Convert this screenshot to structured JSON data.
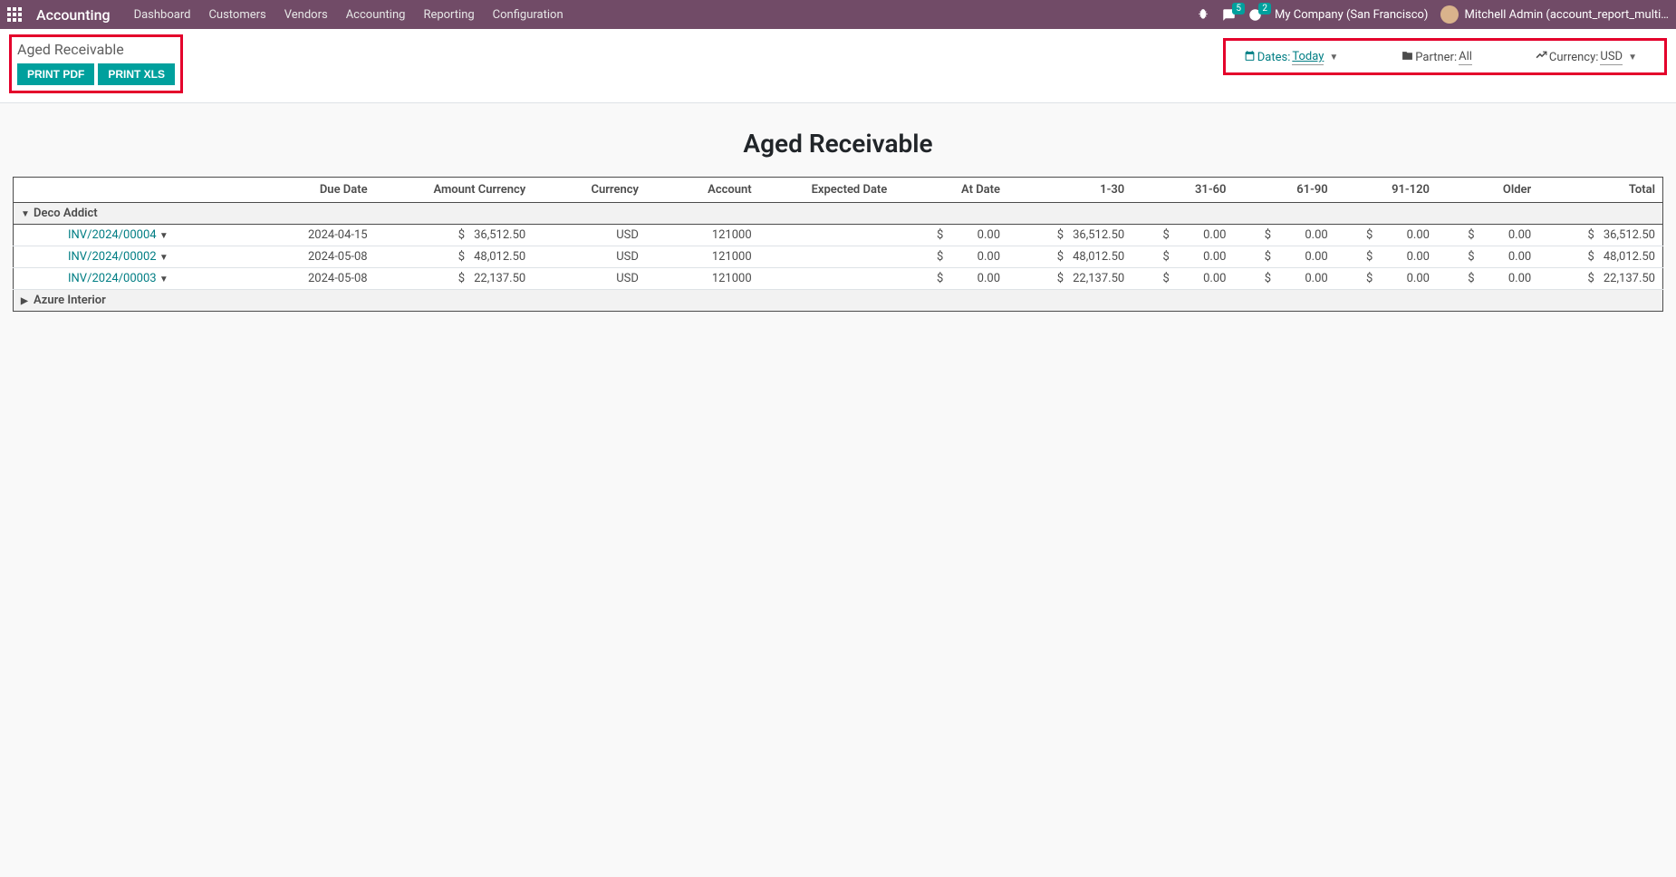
{
  "navbar": {
    "brand": "Accounting",
    "menu": [
      "Dashboard",
      "Customers",
      "Vendors",
      "Accounting",
      "Reporting",
      "Configuration"
    ],
    "chat_badge": "5",
    "activity_badge": "2",
    "company": "My Company (San Francisco)",
    "user": "Mitchell Admin (account_report_multi…"
  },
  "control_panel": {
    "breadcrumb": "Aged Receivable",
    "print_pdf": "PRINT PDF",
    "print_xls": "PRINT XLS",
    "filters": {
      "dates_label": "Dates:",
      "dates_value": "Today",
      "partner_label": "Partner:",
      "partner_value": "All",
      "currency_label": "Currency:",
      "currency_value": "USD"
    }
  },
  "report": {
    "title": "Aged Receivable",
    "headers": {
      "blank": "",
      "due_date": "Due Date",
      "amount_currency": "Amount Currency",
      "currency": "Currency",
      "account": "Account",
      "expected_date": "Expected Date",
      "at_date": "At Date",
      "r1_30": "1-30",
      "r31_60": "31-60",
      "r61_90": "61-90",
      "r91_120": "91-120",
      "older": "Older",
      "total": "Total"
    },
    "groups": [
      {
        "name": "Deco Addict",
        "expanded": true,
        "rows": [
          {
            "invoice": "INV/2024/00004",
            "due_date": "2024-04-15",
            "amount_currency": "36,512.50",
            "currency": "USD",
            "account": "121000",
            "expected_date": "",
            "at_date": "0.00",
            "r1_30": "36,512.50",
            "r31_60": "0.00",
            "r61_90": "0.00",
            "r91_120": "0.00",
            "older": "0.00",
            "total": "36,512.50",
            "sym": "$"
          },
          {
            "invoice": "INV/2024/00002",
            "due_date": "2024-05-08",
            "amount_currency": "48,012.50",
            "currency": "USD",
            "account": "121000",
            "expected_date": "",
            "at_date": "0.00",
            "r1_30": "48,012.50",
            "r31_60": "0.00",
            "r61_90": "0.00",
            "r91_120": "0.00",
            "older": "0.00",
            "total": "48,012.50",
            "sym": "$"
          },
          {
            "invoice": "INV/2024/00003",
            "due_date": "2024-05-08",
            "amount_currency": "22,137.50",
            "currency": "USD",
            "account": "121000",
            "expected_date": "",
            "at_date": "0.00",
            "r1_30": "22,137.50",
            "r31_60": "0.00",
            "r61_90": "0.00",
            "r91_120": "0.00",
            "older": "0.00",
            "total": "22,137.50",
            "sym": "$"
          }
        ]
      },
      {
        "name": "Azure Interior",
        "expanded": false,
        "rows": []
      }
    ]
  }
}
